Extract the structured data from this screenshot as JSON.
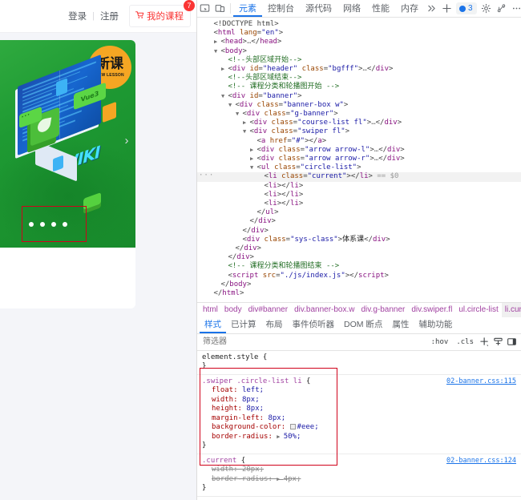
{
  "webpage": {
    "header": {
      "login_label": "登录",
      "separator": "|",
      "register_label": "注册",
      "mycourse_label": "我的课程",
      "cart_icon": "shopping-cart-icon",
      "badge_count": "7"
    },
    "banner": {
      "badge_cn": "新课",
      "badge_en": "NEW LESSON",
      "bubble_vue_label": "Vue3",
      "screen_text": "WIKI",
      "arrow_right": "›",
      "dots": [
        "current",
        "",
        "",
        ""
      ]
    }
  },
  "devtools": {
    "toolbar": {
      "inspect_icon": "inspect-element-icon",
      "device_icon": "device-toolbar-icon",
      "tabs": [
        {
          "label": "元素",
          "active": true
        },
        {
          "label": "控制台",
          "active": false
        },
        {
          "label": "源代码",
          "active": false
        },
        {
          "label": "网络",
          "active": false
        },
        {
          "label": "性能",
          "active": false
        },
        {
          "label": "内存",
          "active": false
        }
      ],
      "more_tabs_icon": "chevron-double-right-icon",
      "add_tab_icon": "plus-icon",
      "issues_count": "3",
      "issues_icon": "issues-dot-icon",
      "settings_icon": "gear-icon",
      "customize_icon": "devtools-branch-icon",
      "more_icon": "ellipsis-icon",
      "close_icon": "close-icon"
    },
    "dom_tree": [
      {
        "indent": 0,
        "tri": "",
        "parts": [
          {
            "t": "punct",
            "v": "<!DOCTYPE html>"
          }
        ]
      },
      {
        "indent": 0,
        "tri": "",
        "parts": [
          {
            "t": "punct",
            "v": "<"
          },
          {
            "t": "tag",
            "v": "html"
          },
          {
            "t": "attr",
            "v": " lang"
          },
          {
            "t": "punct",
            "v": "="
          },
          {
            "t": "val",
            "v": "\"en\""
          },
          {
            "t": "punct",
            "v": ">"
          }
        ]
      },
      {
        "indent": 1,
        "tri": "▶",
        "parts": [
          {
            "t": "punct",
            "v": "<"
          },
          {
            "t": "tag",
            "v": "head"
          },
          {
            "t": "punct",
            "v": ">"
          },
          {
            "t": "ellip",
            "v": "…"
          },
          {
            "t": "punct",
            "v": "</"
          },
          {
            "t": "tag",
            "v": "head"
          },
          {
            "t": "punct",
            "v": ">"
          }
        ]
      },
      {
        "indent": 1,
        "tri": "▼",
        "parts": [
          {
            "t": "punct",
            "v": "<"
          },
          {
            "t": "tag",
            "v": "body"
          },
          {
            "t": "punct",
            "v": ">"
          }
        ]
      },
      {
        "indent": 2,
        "tri": "",
        "parts": [
          {
            "t": "comment",
            "v": "<!--头部区域开始-->"
          }
        ]
      },
      {
        "indent": 2,
        "tri": "▶",
        "parts": [
          {
            "t": "punct",
            "v": "<"
          },
          {
            "t": "tag",
            "v": "div"
          },
          {
            "t": "attr",
            "v": " id"
          },
          {
            "t": "punct",
            "v": "="
          },
          {
            "t": "val",
            "v": "\"header\""
          },
          {
            "t": "attr",
            "v": " class"
          },
          {
            "t": "punct",
            "v": "="
          },
          {
            "t": "val",
            "v": "\"bgfff\""
          },
          {
            "t": "punct",
            "v": ">"
          },
          {
            "t": "ellip",
            "v": "…"
          },
          {
            "t": "punct",
            "v": "</"
          },
          {
            "t": "tag",
            "v": "div"
          },
          {
            "t": "punct",
            "v": ">"
          }
        ]
      },
      {
        "indent": 2,
        "tri": "",
        "parts": [
          {
            "t": "comment",
            "v": "<!--头部区域结束-->"
          }
        ]
      },
      {
        "indent": 2,
        "tri": "",
        "parts": [
          {
            "t": "comment",
            "v": "<!-- 课程分类和轮播图开始 -->"
          }
        ]
      },
      {
        "indent": 2,
        "tri": "▼",
        "parts": [
          {
            "t": "punct",
            "v": "<"
          },
          {
            "t": "tag",
            "v": "div"
          },
          {
            "t": "attr",
            "v": " id"
          },
          {
            "t": "punct",
            "v": "="
          },
          {
            "t": "val",
            "v": "\"banner\""
          },
          {
            "t": "punct",
            "v": ">"
          }
        ]
      },
      {
        "indent": 3,
        "tri": "▼",
        "parts": [
          {
            "t": "punct",
            "v": "<"
          },
          {
            "t": "tag",
            "v": "div"
          },
          {
            "t": "attr",
            "v": " class"
          },
          {
            "t": "punct",
            "v": "="
          },
          {
            "t": "val",
            "v": "\"banner-box w\""
          },
          {
            "t": "punct",
            "v": ">"
          }
        ]
      },
      {
        "indent": 4,
        "tri": "▼",
        "parts": [
          {
            "t": "punct",
            "v": "<"
          },
          {
            "t": "tag",
            "v": "div"
          },
          {
            "t": "attr",
            "v": " class"
          },
          {
            "t": "punct",
            "v": "="
          },
          {
            "t": "val",
            "v": "\"g-banner\""
          },
          {
            "t": "punct",
            "v": ">"
          }
        ]
      },
      {
        "indent": 5,
        "tri": "▶",
        "parts": [
          {
            "t": "punct",
            "v": "<"
          },
          {
            "t": "tag",
            "v": "div"
          },
          {
            "t": "attr",
            "v": " class"
          },
          {
            "t": "punct",
            "v": "="
          },
          {
            "t": "val",
            "v": "\"course-list fl\""
          },
          {
            "t": "punct",
            "v": ">"
          },
          {
            "t": "ellip",
            "v": "…"
          },
          {
            "t": "punct",
            "v": "</"
          },
          {
            "t": "tag",
            "v": "div"
          },
          {
            "t": "punct",
            "v": ">"
          }
        ]
      },
      {
        "indent": 5,
        "tri": "▼",
        "parts": [
          {
            "t": "punct",
            "v": "<"
          },
          {
            "t": "tag",
            "v": "div"
          },
          {
            "t": "attr",
            "v": " class"
          },
          {
            "t": "punct",
            "v": "="
          },
          {
            "t": "val",
            "v": "\"swiper fl\""
          },
          {
            "t": "punct",
            "v": ">"
          }
        ]
      },
      {
        "indent": 6,
        "tri": "",
        "parts": [
          {
            "t": "punct",
            "v": "<"
          },
          {
            "t": "tag",
            "v": "a"
          },
          {
            "t": "attr",
            "v": " href"
          },
          {
            "t": "punct",
            "v": "="
          },
          {
            "t": "val",
            "v": "\"#\""
          },
          {
            "t": "punct",
            "v": "></"
          },
          {
            "t": "tag",
            "v": "a"
          },
          {
            "t": "punct",
            "v": ">"
          }
        ]
      },
      {
        "indent": 6,
        "tri": "▶",
        "parts": [
          {
            "t": "punct",
            "v": "<"
          },
          {
            "t": "tag",
            "v": "div"
          },
          {
            "t": "attr",
            "v": " class"
          },
          {
            "t": "punct",
            "v": "="
          },
          {
            "t": "val",
            "v": "\"arrow arrow-l\""
          },
          {
            "t": "punct",
            "v": ">"
          },
          {
            "t": "ellip",
            "v": "…"
          },
          {
            "t": "punct",
            "v": "</"
          },
          {
            "t": "tag",
            "v": "div"
          },
          {
            "t": "punct",
            "v": ">"
          }
        ]
      },
      {
        "indent": 6,
        "tri": "▶",
        "parts": [
          {
            "t": "punct",
            "v": "<"
          },
          {
            "t": "tag",
            "v": "div"
          },
          {
            "t": "attr",
            "v": " class"
          },
          {
            "t": "punct",
            "v": "="
          },
          {
            "t": "val",
            "v": "\"arrow arrow-r\""
          },
          {
            "t": "punct",
            "v": ">"
          },
          {
            "t": "ellip",
            "v": "…"
          },
          {
            "t": "punct",
            "v": "</"
          },
          {
            "t": "tag",
            "v": "div"
          },
          {
            "t": "punct",
            "v": ">"
          }
        ]
      },
      {
        "indent": 6,
        "tri": "▼",
        "parts": [
          {
            "t": "punct",
            "v": "<"
          },
          {
            "t": "tag",
            "v": "ul"
          },
          {
            "t": "attr",
            "v": " class"
          },
          {
            "t": "punct",
            "v": "="
          },
          {
            "t": "val",
            "v": "\"circle-list\""
          },
          {
            "t": "punct",
            "v": ">"
          }
        ]
      },
      {
        "indent": 7,
        "tri": "",
        "selected": true,
        "parts": [
          {
            "t": "punct",
            "v": "<"
          },
          {
            "t": "tag",
            "v": "li"
          },
          {
            "t": "attr",
            "v": " class"
          },
          {
            "t": "punct",
            "v": "="
          },
          {
            "t": "val",
            "v": "\"current\""
          },
          {
            "t": "punct",
            "v": "></"
          },
          {
            "t": "tag",
            "v": "li"
          },
          {
            "t": "punct",
            "v": ">"
          },
          {
            "t": "dollar",
            "v": " == $0"
          }
        ]
      },
      {
        "indent": 7,
        "tri": "",
        "parts": [
          {
            "t": "punct",
            "v": "<"
          },
          {
            "t": "tag",
            "v": "li"
          },
          {
            "t": "punct",
            "v": "></"
          },
          {
            "t": "tag",
            "v": "li"
          },
          {
            "t": "punct",
            "v": ">"
          }
        ]
      },
      {
        "indent": 7,
        "tri": "",
        "parts": [
          {
            "t": "punct",
            "v": "<"
          },
          {
            "t": "tag",
            "v": "li"
          },
          {
            "t": "punct",
            "v": "></"
          },
          {
            "t": "tag",
            "v": "li"
          },
          {
            "t": "punct",
            "v": ">"
          }
        ]
      },
      {
        "indent": 7,
        "tri": "",
        "parts": [
          {
            "t": "punct",
            "v": "<"
          },
          {
            "t": "tag",
            "v": "li"
          },
          {
            "t": "punct",
            "v": "></"
          },
          {
            "t": "tag",
            "v": "li"
          },
          {
            "t": "punct",
            "v": ">"
          }
        ]
      },
      {
        "indent": 6,
        "tri": "",
        "parts": [
          {
            "t": "punct",
            "v": "</"
          },
          {
            "t": "tag",
            "v": "ul"
          },
          {
            "t": "punct",
            "v": ">"
          }
        ]
      },
      {
        "indent": 5,
        "tri": "",
        "parts": [
          {
            "t": "punct",
            "v": "</"
          },
          {
            "t": "tag",
            "v": "div"
          },
          {
            "t": "punct",
            "v": ">"
          }
        ]
      },
      {
        "indent": 4,
        "tri": "",
        "parts": [
          {
            "t": "punct",
            "v": "</"
          },
          {
            "t": "tag",
            "v": "div"
          },
          {
            "t": "punct",
            "v": ">"
          }
        ]
      },
      {
        "indent": 4,
        "tri": "",
        "parts": [
          {
            "t": "punct",
            "v": "<"
          },
          {
            "t": "tag",
            "v": "div"
          },
          {
            "t": "attr",
            "v": " class"
          },
          {
            "t": "punct",
            "v": "="
          },
          {
            "t": "val",
            "v": "\"sys-class\""
          },
          {
            "t": "punct",
            "v": ">"
          },
          {
            "t": "txt",
            "v": "体系课"
          },
          {
            "t": "punct",
            "v": "</"
          },
          {
            "t": "tag",
            "v": "div"
          },
          {
            "t": "punct",
            "v": ">"
          }
        ]
      },
      {
        "indent": 3,
        "tri": "",
        "parts": [
          {
            "t": "punct",
            "v": "</"
          },
          {
            "t": "tag",
            "v": "div"
          },
          {
            "t": "punct",
            "v": ">"
          }
        ]
      },
      {
        "indent": 2,
        "tri": "",
        "parts": [
          {
            "t": "punct",
            "v": "</"
          },
          {
            "t": "tag",
            "v": "div"
          },
          {
            "t": "punct",
            "v": ">"
          }
        ]
      },
      {
        "indent": 2,
        "tri": "",
        "parts": [
          {
            "t": "comment",
            "v": "<!-- 课程分类和轮播图结束 -->"
          }
        ]
      },
      {
        "indent": 2,
        "tri": "",
        "parts": [
          {
            "t": "punct",
            "v": "<"
          },
          {
            "t": "tag",
            "v": "script"
          },
          {
            "t": "attr",
            "v": " src"
          },
          {
            "t": "punct",
            "v": "="
          },
          {
            "t": "val",
            "v": "\"./js/index.js\""
          },
          {
            "t": "punct",
            "v": "></"
          },
          {
            "t": "tag",
            "v": "script"
          },
          {
            "t": "punct",
            "v": ">"
          }
        ]
      },
      {
        "indent": 1,
        "tri": "",
        "parts": [
          {
            "t": "punct",
            "v": "</"
          },
          {
            "t": "tag",
            "v": "body"
          },
          {
            "t": "punct",
            "v": ">"
          }
        ]
      },
      {
        "indent": 0,
        "tri": "",
        "parts": [
          {
            "t": "punct",
            "v": "</"
          },
          {
            "t": "tag",
            "v": "html"
          },
          {
            "t": "punct",
            "v": ">"
          }
        ]
      }
    ],
    "breadcrumb": [
      {
        "label": "html",
        "selected": false
      },
      {
        "label": "body",
        "selected": false
      },
      {
        "label": "div#banner",
        "selected": false
      },
      {
        "label": "div.banner-box.w",
        "selected": false
      },
      {
        "label": "div.g-banner",
        "selected": false
      },
      {
        "label": "div.swiper.fl",
        "selected": false
      },
      {
        "label": "ul.circle-list",
        "selected": false
      },
      {
        "label": "li.current",
        "selected": true
      }
    ],
    "subtabs": [
      {
        "label": "样式",
        "active": true
      },
      {
        "label": "已计算",
        "active": false
      },
      {
        "label": "布局",
        "active": false
      },
      {
        "label": "事件侦听器",
        "active": false
      },
      {
        "label": "DOM 断点",
        "active": false
      },
      {
        "label": "属性",
        "active": false
      },
      {
        "label": "辅助功能",
        "active": false
      }
    ],
    "filterbar": {
      "placeholder": "筛选器",
      "value": "",
      "hov_label": ":hov",
      "cls_label": ".cls",
      "new_rule_icon": "plus-icon",
      "print_icon": "computed-styles-icon",
      "sidebar_icon": "toggle-sidebar-icon"
    },
    "styles": {
      "element_style": {
        "selector": "element.style",
        "open_brace": "{",
        "close_brace": "}",
        "properties": []
      },
      "rules": [
        {
          "selector": ".swiper .circle-list li",
          "open_brace": "{",
          "close_brace": "}",
          "source": "02-banner.css:115",
          "properties": [
            {
              "name": "float",
              "value": "left",
              "disabled": false,
              "swatch": false,
              "expander": false
            },
            {
              "name": "width",
              "value": "8px",
              "disabled": false,
              "swatch": false,
              "expander": false
            },
            {
              "name": "height",
              "value": "8px",
              "disabled": false,
              "swatch": false,
              "expander": false
            },
            {
              "name": "margin-left",
              "value": "8px",
              "disabled": false,
              "swatch": false,
              "expander": false
            },
            {
              "name": "background-color",
              "value": "#eee",
              "disabled": false,
              "swatch": true,
              "expander": false
            },
            {
              "name": "border-radius",
              "value": "50%",
              "disabled": false,
              "swatch": false,
              "expander": true
            }
          ]
        },
        {
          "selector": ".current",
          "open_brace": "{",
          "close_brace": "}",
          "source": "02-banner.css:124",
          "properties": [
            {
              "name": "width",
              "value": "20px",
              "disabled": true,
              "swatch": false,
              "expander": false
            },
            {
              "name": "border-radius",
              "value": "4px",
              "disabled": true,
              "swatch": false,
              "expander": true
            }
          ]
        }
      ]
    }
  }
}
